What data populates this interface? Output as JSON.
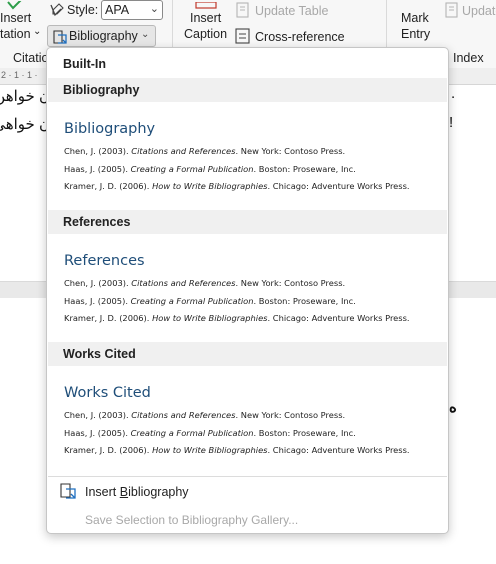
{
  "ribbon": {
    "insert_citation_top": "Insert",
    "insert_citation_bottom": "tation",
    "citations_group": "Citation",
    "style_label": "Style:",
    "style_value": "APA",
    "bibliography_button": "Bibliography",
    "insert_caption_top": "Insert",
    "insert_caption_bottom": "Caption",
    "update_table": "Update Table",
    "cross_reference": "Cross-reference",
    "mark_entry_top": "Mark",
    "mark_entry_bottom": "Entry",
    "update_partial": "Update",
    "index_group": "Index"
  },
  "document": {
    "line1": "ن خواهن",
    "line2": "ن خواهی",
    "line3": "ه",
    "ruler_marks": "2 · 1 · 1 ·"
  },
  "dropdown": {
    "section_builtin": "Built-In",
    "gallery": [
      {
        "band_label": "Bibliography",
        "heading": "Bibliography"
      },
      {
        "band_label": "References",
        "heading": "References"
      },
      {
        "band_label": "Works Cited",
        "heading": "Works Cited"
      }
    ],
    "citations": [
      {
        "pre": "Chen, J. (2003). ",
        "title": "Citations and References",
        "post": ". New York: Contoso Press."
      },
      {
        "pre": "Haas, J. (2005). ",
        "title": "Creating a Formal Publication",
        "post": ". Boston: Proseware, Inc."
      },
      {
        "pre": "Kramer, J. D. (2006). ",
        "title": "How to Write Bibliographies",
        "post": ". Chicago: Adventure Works Press."
      }
    ],
    "insert_bibliography_pre": "Insert ",
    "insert_bibliography_ul": "B",
    "insert_bibliography_post": "ibliography",
    "save_selection": "Save Selection to Bibliography Gallery..."
  }
}
